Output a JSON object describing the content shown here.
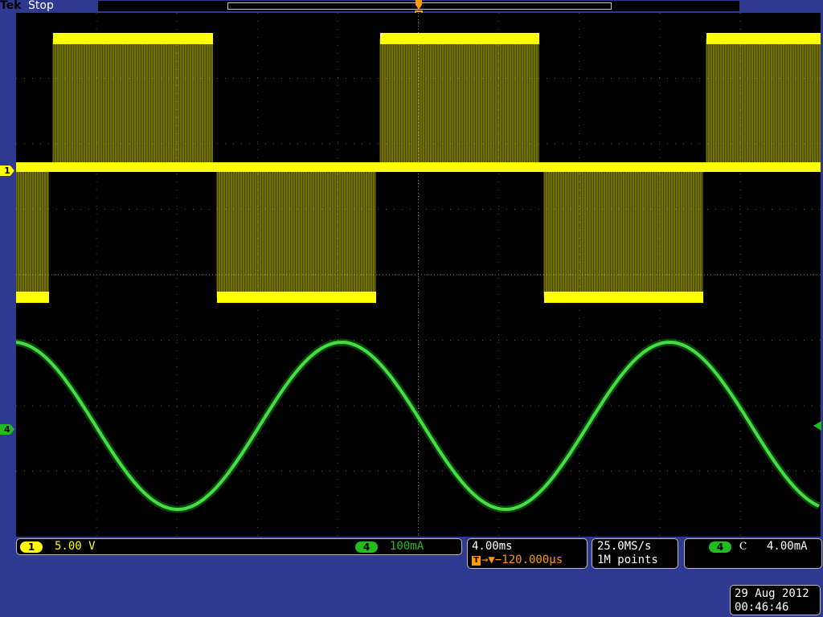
{
  "header": {
    "brand": "Tek",
    "acq_state": "Stop"
  },
  "markers": {
    "ch1": "1",
    "ch4": "4",
    "trigger_pos": "T"
  },
  "channel_readout": {
    "ch1": {
      "badge": "1",
      "scale": "5.00 V"
    },
    "ch4": {
      "badge": "4",
      "scale": "100mA"
    }
  },
  "timebase": {
    "scale": "4.00ms",
    "trig_position": "→▼−120.000μs",
    "trig_badge": "T"
  },
  "acquisition": {
    "sample_rate": "25.0MS/s",
    "record_length": "1M points"
  },
  "trigger": {
    "source_badge": "4",
    "slope_icon": "Ⲥ",
    "level": "4.00mA"
  },
  "datetime": {
    "date": "29 Aug 2012",
    "time": "00:46:46"
  },
  "colors": {
    "ch1": "#ffff00",
    "ch4": "#22bb22",
    "background": "#2e3a8f",
    "readout_orange": "#ff9900"
  }
}
